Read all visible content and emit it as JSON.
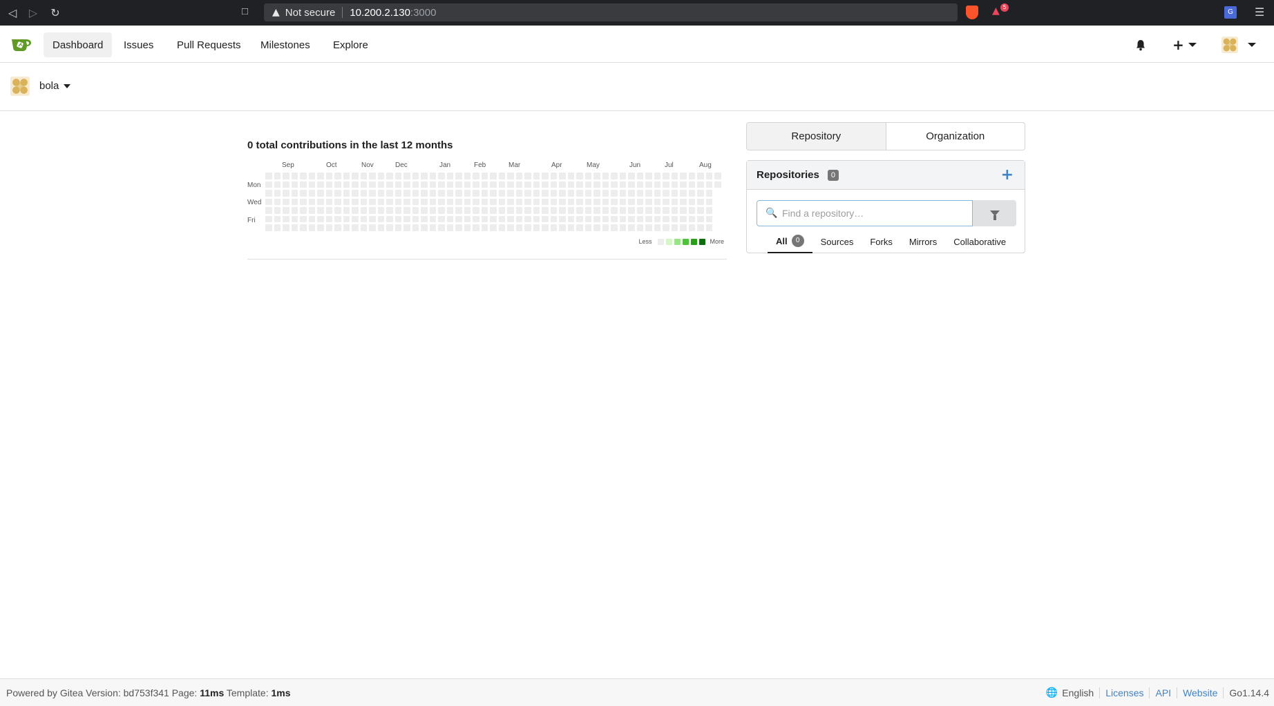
{
  "browser": {
    "security_text": "Not secure",
    "url_host": "10.200.2.130",
    "url_port": ":3000"
  },
  "nav": {
    "items": [
      {
        "label": "Dashboard"
      },
      {
        "label": "Issues"
      },
      {
        "label": "Pull Requests"
      },
      {
        "label": "Milestones"
      },
      {
        "label": "Explore"
      }
    ],
    "plus_label": "+"
  },
  "context": {
    "username": "bola"
  },
  "contributions": {
    "title": "0 total contributions in the last 12 months",
    "months": [
      "Sep",
      "Oct",
      "Nov",
      "Dec",
      "Jan",
      "Feb",
      "Mar",
      "Apr",
      "May",
      "Jun",
      "Jul",
      "Aug"
    ],
    "day_labels": [
      "Mon",
      "Wed",
      "Fri"
    ],
    "legend_less": "Less",
    "legend_more": "More",
    "legend_colors": [
      "#ededed",
      "#d6f5c9",
      "#9be38a",
      "#4fc23b",
      "#2a9d1a",
      "#0e6b0e"
    ],
    "empty_color": "#ededed"
  },
  "right_panel": {
    "tabs": [
      {
        "label": "Repository"
      },
      {
        "label": "Organization"
      }
    ],
    "repos_title": "Repositories",
    "repos_count": "0",
    "search_placeholder": "Find a repository…",
    "filter_tabs": [
      {
        "label": "All",
        "count": "0"
      },
      {
        "label": "Sources"
      },
      {
        "label": "Forks"
      },
      {
        "label": "Mirrors"
      },
      {
        "label": "Collaborative"
      }
    ]
  },
  "footer": {
    "powered": "Powered by Gitea Version: bd753f341 Page: ",
    "page_time": "11ms",
    "template_label": " Template: ",
    "template_time": "1ms",
    "language": "English",
    "links": [
      "Licenses",
      "API",
      "Website"
    ],
    "go_version": "Go1.14.4"
  }
}
